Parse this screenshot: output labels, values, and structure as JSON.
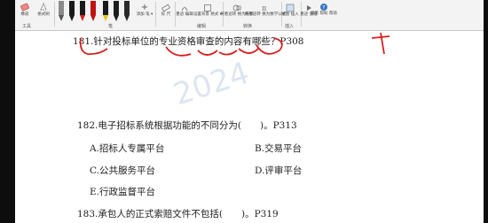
{
  "toolbar": {
    "buttons": [
      {
        "label": "橡皮"
      },
      {
        "label": "格式刷"
      },
      {
        "label": "添加\n笔 ▾"
      },
      {
        "label": "标\n尺"
      },
      {
        "label": "墨迹\n编辑"
      },
      {
        "label": "设置背景\n格式 ▾"
      },
      {
        "label": "将墨迹转\n换为形状"
      },
      {
        "label": "将墨迹转\n换为数学公式"
      },
      {
        "label": "绘图\n插入"
      },
      {
        "label": "墨迹\n重播"
      },
      {
        "label": "显示\n帮助\n帮助"
      }
    ],
    "groups": {
      "tools": "工具",
      "pens": "笔",
      "edit": "编辑",
      "convert": "转换",
      "insert": "插入",
      "help": "帮助"
    },
    "pen_colors": [
      "#7a7a7a",
      "#1a1a1a",
      "#d61f1f",
      "#c21212",
      "#f0c400",
      "#1d1d1d",
      "#2a2a2a"
    ]
  },
  "document": {
    "q181": "181.针对投标单位的专业资格审查的内容有哪些？P308",
    "q182": "182.电子招标系统根据功能的不同分为(　　)。P313",
    "options": {
      "a": "A.招标人专属平台",
      "b": "B.交易平台",
      "c": "C.公共服务平台",
      "d": "D.评审平台",
      "e": "E.行政监督平台"
    },
    "q183": "183.承包人的正式索赔文件不包括(　　)。P319",
    "watermark": "2024"
  }
}
